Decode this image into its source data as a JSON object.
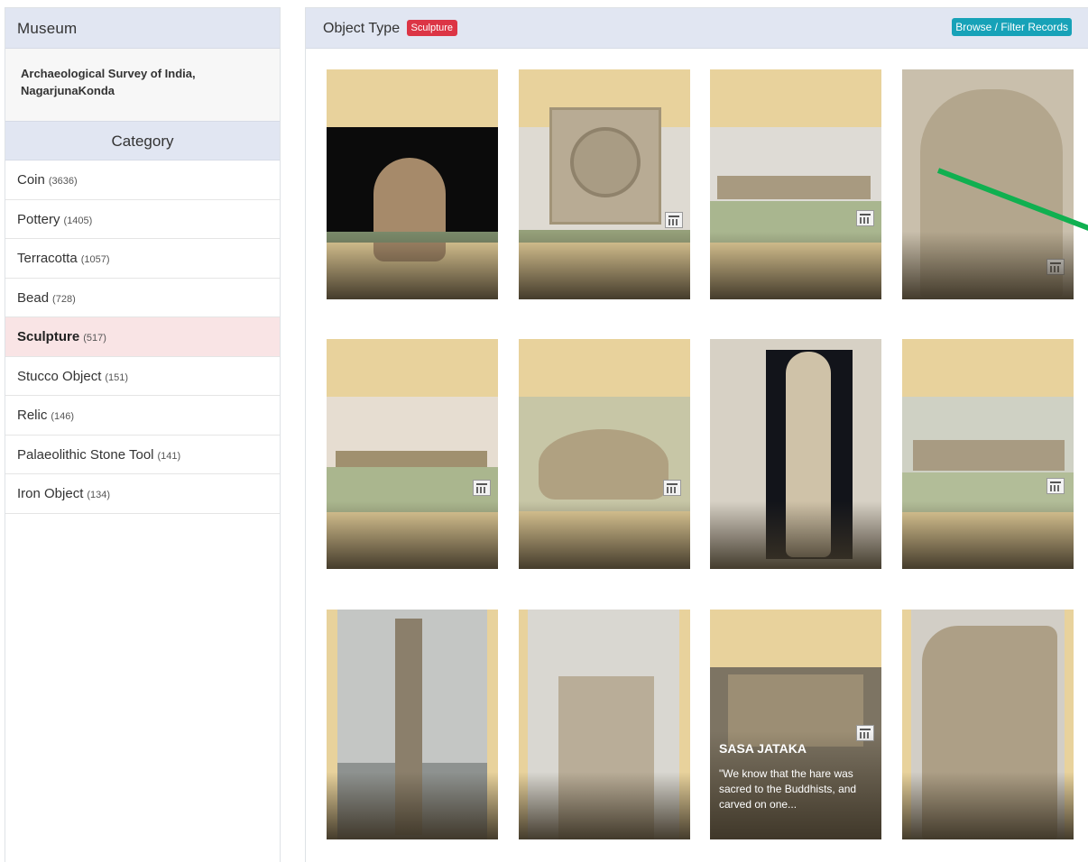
{
  "sidebar": {
    "museum_heading": "Museum",
    "museum_name_line1": "Archaeological Survey of India,",
    "museum_name_line2": "NagarjunaKonda",
    "category_heading": "Category",
    "categories": [
      {
        "label": "Coin",
        "count": "(3636)"
      },
      {
        "label": "Pottery",
        "count": "(1405)"
      },
      {
        "label": "Terracotta",
        "count": "(1057)"
      },
      {
        "label": "Bead",
        "count": "(728)"
      },
      {
        "label": "Sculpture",
        "count": "(517)"
      },
      {
        "label": "Stucco Object",
        "count": "(151)"
      },
      {
        "label": "Relic",
        "count": "(146)"
      },
      {
        "label": "Palaeolithic Stone Tool",
        "count": "(141)"
      },
      {
        "label": "Iron Object",
        "count": "(134)"
      }
    ],
    "active_category": "Sculpture"
  },
  "main": {
    "header_label": "Object Type",
    "object_type_badge": "Sculpture",
    "browse_button": "Browse / Filter Records",
    "hover_card": {
      "title": "SASA JATAKA",
      "excerpt": "\"We know that the hare was sacred to the Buddhists, and carved on one..."
    }
  },
  "colors": {
    "header_bg": "#e1e6f2",
    "active_category_bg": "#f9e4e5",
    "badge_red": "#dc3545",
    "button_teal": "#17a2b8",
    "card_placeholder": "#e8d29c",
    "annotation_arrow": "#10b050"
  }
}
